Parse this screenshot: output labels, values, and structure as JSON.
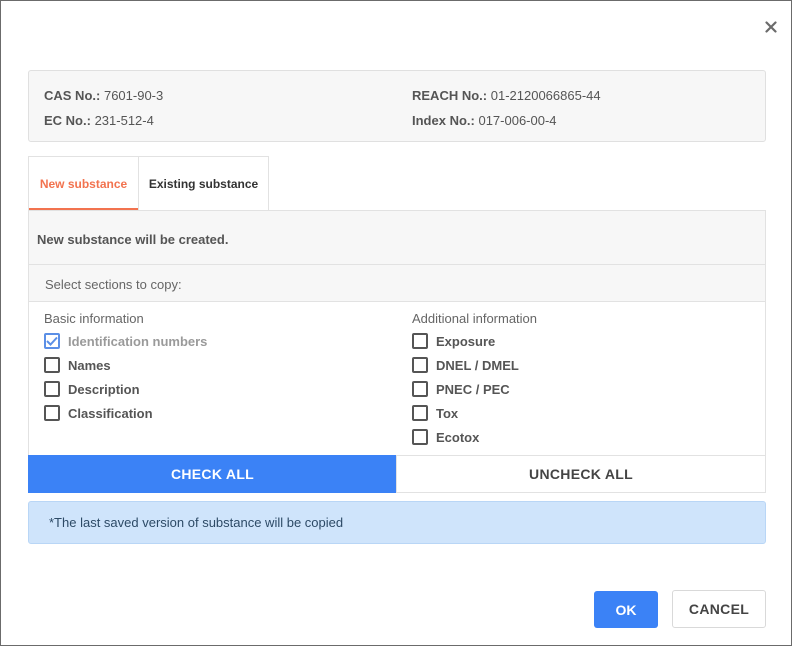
{
  "info": {
    "cas_label": "CAS No.:",
    "cas_value": "7601-90-3",
    "ec_label": "EC No.:",
    "ec_value": "231-512-4",
    "reach_label": "REACH No.:",
    "reach_value": "01-2120066865-44",
    "index_label": "Index No.:",
    "index_value": "017-006-00-4"
  },
  "tabs": [
    {
      "label": "New substance",
      "active": true
    },
    {
      "label": "Existing substance",
      "active": false
    }
  ],
  "panel": {
    "message": "New substance will be created.",
    "select_label": "Select sections to copy:"
  },
  "basic": {
    "title": "Basic information",
    "items": [
      {
        "label": "Identification numbers",
        "checked": true,
        "disabled": true
      },
      {
        "label": "Names",
        "checked": false
      },
      {
        "label": "Description",
        "checked": false
      },
      {
        "label": "Classification",
        "checked": false
      }
    ]
  },
  "additional": {
    "title": "Additional information",
    "items": [
      {
        "label": "Exposure",
        "checked": false
      },
      {
        "label": "DNEL / DMEL",
        "checked": false
      },
      {
        "label": "PNEC / PEC",
        "checked": false
      },
      {
        "label": "Tox",
        "checked": false
      },
      {
        "label": "Ecotox",
        "checked": false
      }
    ]
  },
  "buttons": {
    "check_all": "CHECK ALL",
    "uncheck_all": "UNCHECK ALL",
    "ok": "OK",
    "cancel": "CANCEL"
  },
  "note": "*The last saved version of substance will be copied",
  "icons": {
    "close": "close-icon",
    "check": "checkmark-icon"
  },
  "colors": {
    "accent_orange": "#f2734f",
    "primary_blue": "#3b82f6",
    "note_bg": "#cfe4fb"
  }
}
